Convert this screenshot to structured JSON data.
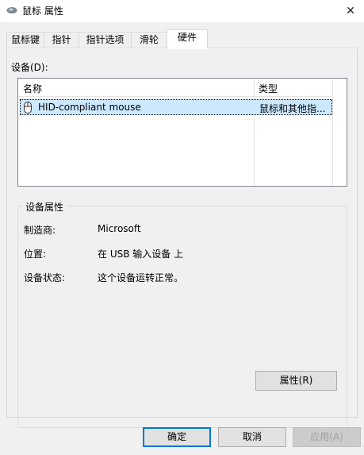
{
  "window": {
    "title": "鼠标 属性",
    "close_glyph": "✕"
  },
  "tabs": [
    {
      "label": "鼠标键"
    },
    {
      "label": "指针"
    },
    {
      "label": "指针选项"
    },
    {
      "label": "滑轮"
    },
    {
      "label": "硬件"
    }
  ],
  "devices": {
    "label": "设备(D):",
    "columns": [
      "名称",
      "类型"
    ],
    "rows": [
      {
        "name": "HID-compliant mouse",
        "type": "鼠标和其他指..."
      }
    ]
  },
  "properties": {
    "group_title": "设备属性",
    "manufacturer_label": "制造商:",
    "manufacturer_value": "Microsoft",
    "location_label": "位置:",
    "location_value": "在 USB 输入设备 上",
    "status_label": "设备状态:",
    "status_value": "这个设备运转正常。",
    "properties_button": "属性(R)"
  },
  "footer": {
    "ok": "确定",
    "cancel": "取消",
    "apply": "应用(A)"
  }
}
